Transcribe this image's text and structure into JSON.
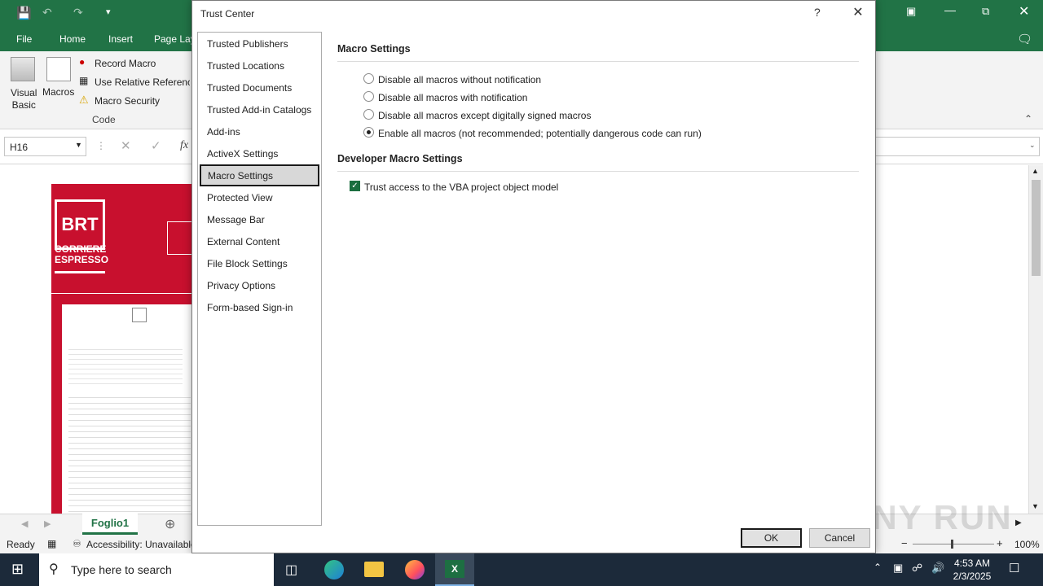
{
  "excel": {
    "ribbon_tabs": [
      "File",
      "Home",
      "Insert",
      "Page Lay"
    ],
    "code_group": {
      "visual_basic_label": "Visual Basic",
      "visual_basic_line1": "Visual",
      "visual_basic_line2": "Basic",
      "macros_label": "Macros",
      "record_macro": "Record Macro",
      "use_relative": "Use Relative References",
      "macro_security": "Macro Security",
      "group_name": "Code"
    },
    "name_box": "H16",
    "fx_label": "fx",
    "sheet_tab": "Foglio1",
    "status_ready": "Ready",
    "accessibility": "Accessibility: Unavailable",
    "zoom": "100%",
    "brand": {
      "logo": "BRT",
      "line1": "CORRIERE",
      "line2": "ESPRESSO"
    }
  },
  "dialog": {
    "title": "Trust Center",
    "help": "?",
    "nav_items": [
      "Trusted Publishers",
      "Trusted Locations",
      "Trusted Documents",
      "Trusted Add-in Catalogs",
      "Add-ins",
      "ActiveX Settings",
      "Macro Settings",
      "Protected View",
      "Message Bar",
      "External Content",
      "File Block Settings",
      "Privacy Options",
      "Form-based Sign-in"
    ],
    "selected_nav": "Macro Settings",
    "macro_section_title": "Macro Settings",
    "macro_options": [
      {
        "label": "Disable all macros without notification",
        "selected": false
      },
      {
        "label": "Disable all macros with notification",
        "selected": false
      },
      {
        "label": "Disable all macros except digitally signed macros",
        "selected": false
      },
      {
        "label": "Enable all macros (not recommended; potentially dangerous code can run)",
        "selected": true
      }
    ],
    "dev_section_title": "Developer Macro Settings",
    "vba_checkbox": {
      "label": "Trust access to the VBA project object model",
      "checked": true
    },
    "ok_label": "OK",
    "cancel_label": "Cancel"
  },
  "taskbar": {
    "search_placeholder": "Type here to search",
    "time": "4:53 AM",
    "date": "2/3/2025"
  },
  "watermark": "ANY RUN",
  "colors": {
    "excel_green": "#217346",
    "brand_red": "#c8102e",
    "taskbar": "#1c2a3a"
  }
}
